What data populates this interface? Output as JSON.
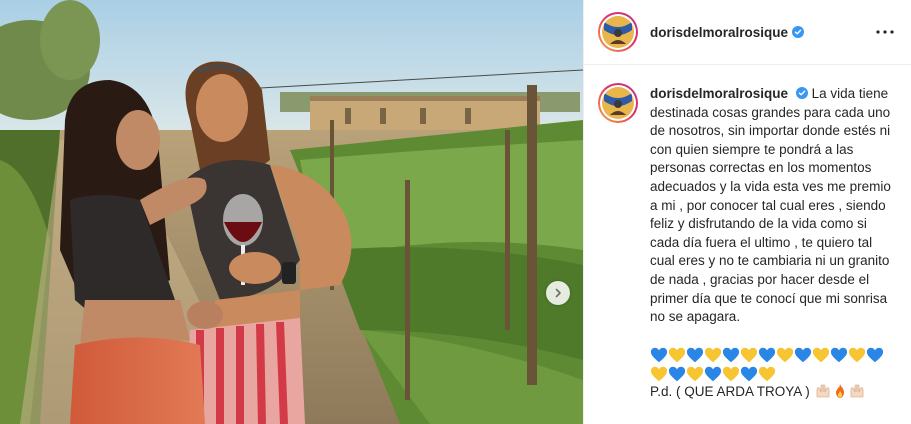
{
  "post": {
    "username": "dorisdelmoralrosique",
    "verified_icon": "verified-badge-icon",
    "more_icon": "more-options-icon",
    "next_icon": "chevron-right-icon"
  },
  "caption": {
    "username": "dorisdelmoralrosique",
    "text": "La vida tiene destinada cosas grandes para cada uno de nosotros, sin importar donde estés ni con quien siempre te pondrá a las personas correctas en los momentos adecuados y la vida esta ves me premio a mi , por conocer tal cual eres , siendo feliz y disfrutando de la vida como si cada día fuera el ultimo , te quiero tal cual eres y no te cambiaria ni un granito de nada , gracias por hacer desde el primer día que te conocí que mi sonrisa no se apagara.",
    "hearts": [
      "💙",
      "💛",
      "💙",
      "💛",
      "💙",
      "💛",
      "💙",
      "💛",
      "💙",
      "💛",
      "💙",
      "💛",
      "💙",
      "💛",
      "💙",
      "💛",
      "💙",
      "💛",
      "💙",
      "💛"
    ],
    "ps_text": "P.d. ( QUE ARDA TROYA )",
    "ps_emojis": [
      "🙌🏻",
      "🔥",
      "🙌🏻"
    ]
  },
  "colors": {
    "verified_blue": "#3897f0",
    "heart_blue": "#2a86e6",
    "heart_yellow": "#f7c531",
    "avatar_ring_start": "#f9a83a",
    "avatar_ring_end": "#c13584"
  }
}
